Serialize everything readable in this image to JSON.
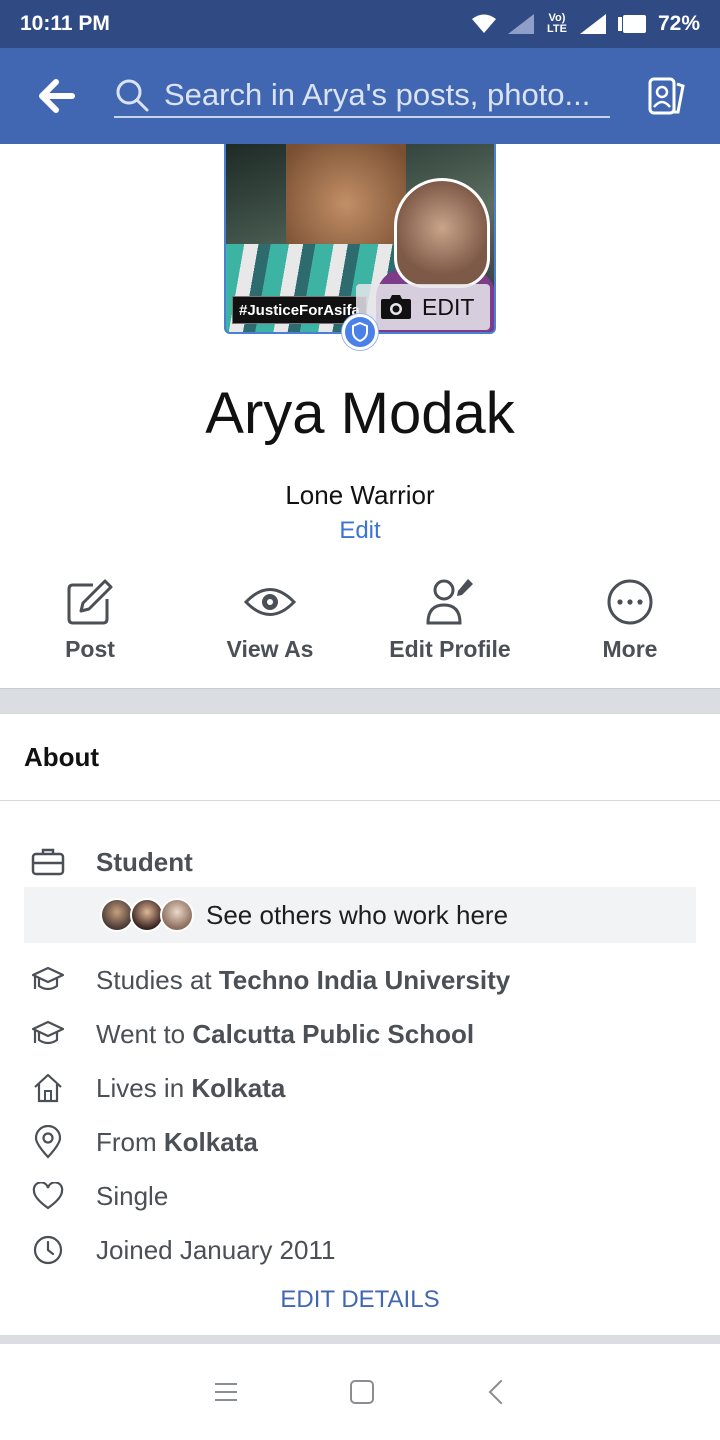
{
  "status_bar": {
    "time": "10:11 PM",
    "network": "Vo) LTE",
    "battery": "72%"
  },
  "app_bar": {
    "search_placeholder": "Search in Arya's posts, photo..."
  },
  "profile_photo": {
    "hashtag": "#JusticeForAsifa",
    "edit_label": "EDIT"
  },
  "profile": {
    "name": "Arya Modak",
    "bio": "Lone Warrior",
    "bio_edit": "Edit"
  },
  "actions": [
    {
      "label": "Post",
      "icon": "compose-icon"
    },
    {
      "label": "View As",
      "icon": "eye-icon"
    },
    {
      "label": "Edit Profile",
      "icon": "edit-person-icon"
    },
    {
      "label": "More",
      "icon": "more-icon"
    }
  ],
  "about": {
    "title": "About",
    "work": {
      "label": "Student",
      "coworkers_text": "See others who work here"
    },
    "studies": {
      "prefix": "Studies at ",
      "place": "Techno India University"
    },
    "school": {
      "prefix": "Went to ",
      "place": "Calcutta Public School"
    },
    "lives": {
      "prefix": "Lives in ",
      "place": "Kolkata"
    },
    "from": {
      "prefix": "From ",
      "place": "Kolkata"
    },
    "relationship": "Single",
    "joined": "Joined January 2011",
    "edit_details": "EDIT DETAILS"
  },
  "colors": {
    "brand_blue": "#4267b2",
    "status_bar": "#304a84",
    "link_blue": "#3b74d6"
  }
}
